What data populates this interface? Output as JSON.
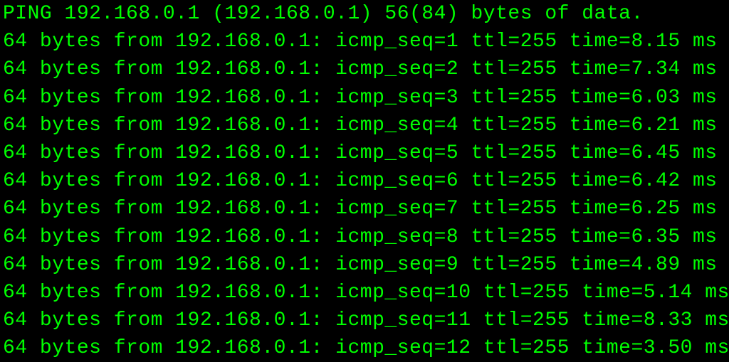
{
  "terminal": {
    "header": "PING 192.168.0.1 (192.168.0.1) 56(84) bytes of data.",
    "lines": [
      "64 bytes from 192.168.0.1: icmp_seq=1 ttl=255 time=8.15 ms",
      "64 bytes from 192.168.0.1: icmp_seq=2 ttl=255 time=7.34 ms",
      "64 bytes from 192.168.0.1: icmp_seq=3 ttl=255 time=6.03 ms",
      "64 bytes from 192.168.0.1: icmp_seq=4 ttl=255 time=6.21 ms",
      "64 bytes from 192.168.0.1: icmp_seq=5 ttl=255 time=6.45 ms",
      "64 bytes from 192.168.0.1: icmp_seq=6 ttl=255 time=6.42 ms",
      "64 bytes from 192.168.0.1: icmp_seq=7 ttl=255 time=6.25 ms",
      "64 bytes from 192.168.0.1: icmp_seq=8 ttl=255 time=6.35 ms",
      "64 bytes from 192.168.0.1: icmp_seq=9 ttl=255 time=4.89 ms",
      "64 bytes from 192.168.0.1: icmp_seq=10 ttl=255 time=5.14 ms",
      "64 bytes from 192.168.0.1: icmp_seq=11 ttl=255 time=8.33 ms",
      "64 bytes from 192.168.0.1: icmp_seq=12 ttl=255 time=3.50 ms"
    ]
  }
}
